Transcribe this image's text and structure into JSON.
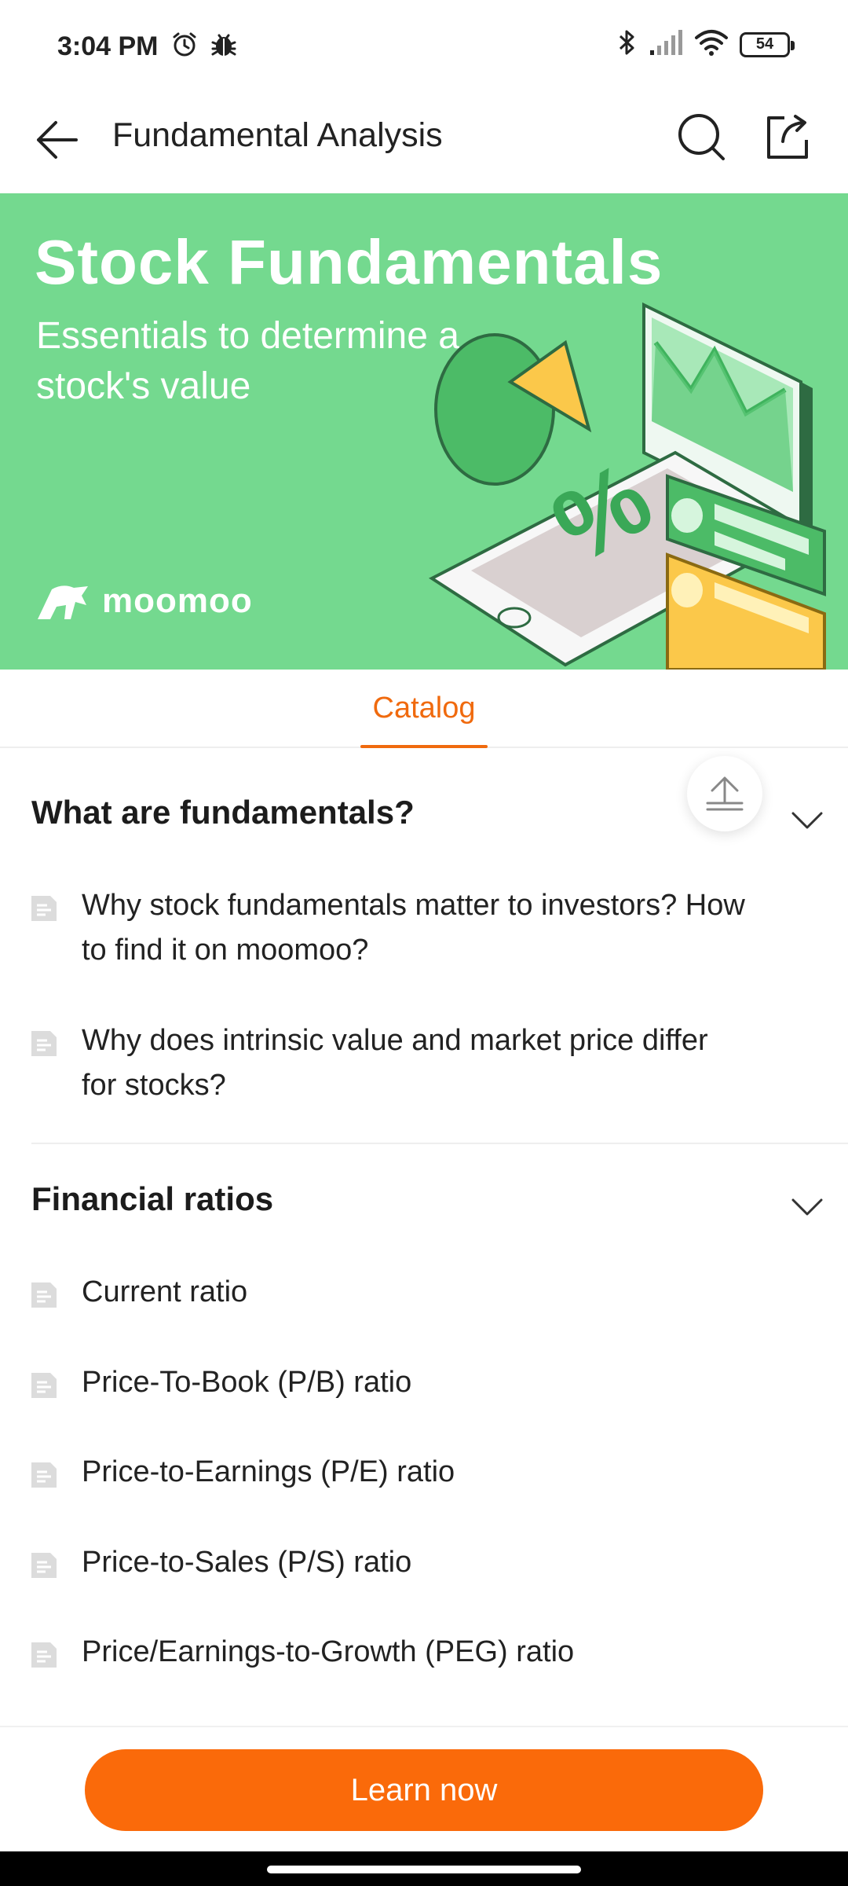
{
  "status_bar": {
    "time": "3:04 PM",
    "battery": "54",
    "icons": [
      "alarm-icon",
      "bug-icon",
      "bluetooth-icon",
      "signal-icon",
      "wifi-icon",
      "battery-icon"
    ]
  },
  "header": {
    "title": "Fundamental Analysis",
    "icons": [
      "back-arrow-icon",
      "search-icon",
      "share-icon"
    ]
  },
  "banner": {
    "title": "Stock Fundamentals",
    "subtitle": "Essentials to determine a stock's value",
    "brand": "moomoo",
    "background_color": "#74d98f"
  },
  "tabs": [
    {
      "label": "Catalog",
      "active": true
    }
  ],
  "catalog": {
    "sections": [
      {
        "title": "What are fundamentals?",
        "expanded": true,
        "items": [
          {
            "label": "Why stock fundamentals matter to investors? How to find it on moomoo?"
          },
          {
            "label": "Why does intrinsic value and market price differ for stocks?"
          }
        ]
      },
      {
        "title": "Financial ratios",
        "expanded": true,
        "items": [
          {
            "label": "Current ratio"
          },
          {
            "label": "Price-To-Book (P/B) ratio"
          },
          {
            "label": "Price-to-Earnings (P/E) ratio"
          },
          {
            "label": "Price-to-Sales (P/S) ratio"
          },
          {
            "label": "Price/Earnings-to-Growth (PEG) ratio"
          }
        ]
      }
    ]
  },
  "cta": {
    "label": "Learn now",
    "color": "#fa6a0a"
  },
  "accent_color": "#f06a0e"
}
